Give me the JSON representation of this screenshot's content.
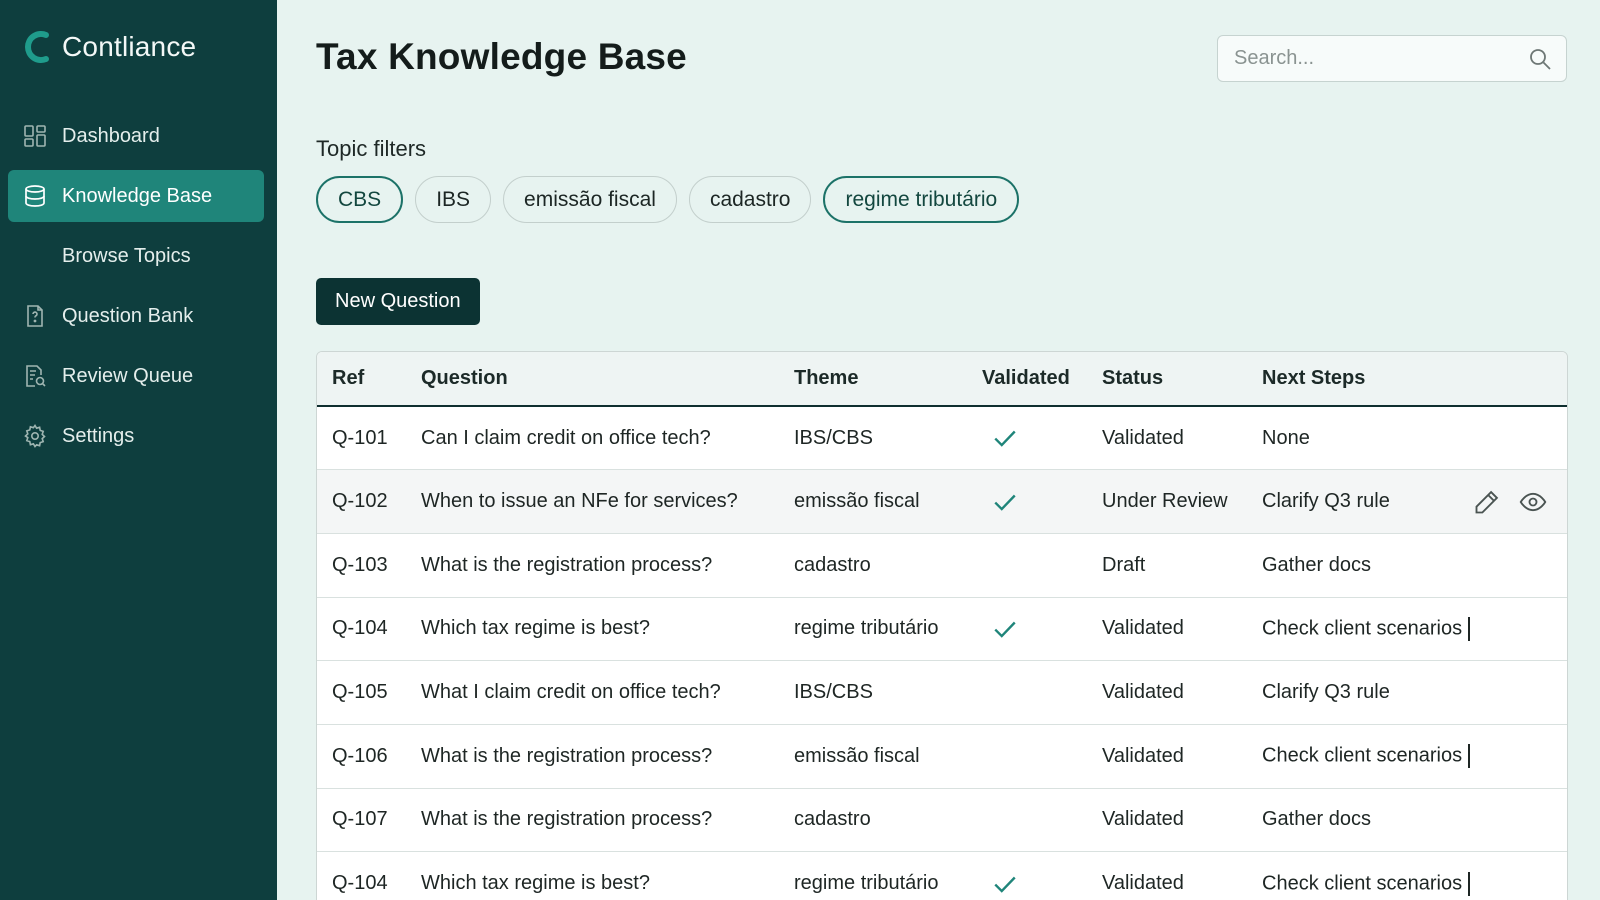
{
  "brand": {
    "name": "Contliance",
    "accent": "#1f857a"
  },
  "sidebar": {
    "items": [
      {
        "label": "Dashboard",
        "icon": "grid-icon",
        "active": false
      },
      {
        "label": "Knowledge Base",
        "icon": "database-icon",
        "active": true
      },
      {
        "label": "Browse Topics",
        "icon": "",
        "active": false
      },
      {
        "label": "Question Bank",
        "icon": "question-file-icon",
        "active": false
      },
      {
        "label": "Review Queue",
        "icon": "review-search-icon",
        "active": false
      },
      {
        "label": "Settings",
        "icon": "gear-icon",
        "active": false
      }
    ]
  },
  "header": {
    "title": "Tax Knowledge Base",
    "search_placeholder": "Search..."
  },
  "filters": {
    "label": "Topic filters",
    "chips": [
      {
        "label": "CBS",
        "selected": true
      },
      {
        "label": "IBS",
        "selected": false
      },
      {
        "label": "emissão fiscal",
        "selected": false
      },
      {
        "label": "cadastro",
        "selected": false
      },
      {
        "label": "regime tributário",
        "selected": true
      }
    ]
  },
  "actions": {
    "new_question": "New Question"
  },
  "table": {
    "columns": [
      "Ref",
      "Question",
      "Theme",
      "Validated",
      "Status",
      "Next Steps"
    ],
    "rows": [
      {
        "ref": "Q-101",
        "question": "Can I claim credit on office tech?",
        "theme": "IBS/CBS",
        "validated": true,
        "status": "Validated",
        "next": "None"
      },
      {
        "ref": "Q-102",
        "question": "When to issue an NFe for services?",
        "theme": "emissão fiscal",
        "validated": true,
        "status": "Under Review",
        "next": "Clarify Q3 rule"
      },
      {
        "ref": "Q-103",
        "question": "What is the registration process?",
        "theme": "cadastro",
        "validated": false,
        "status": "Draft",
        "next": "Gather docs"
      },
      {
        "ref": "Q-104",
        "question": "Which tax regime is best?",
        "theme": "regime tributário",
        "validated": true,
        "status": "Validated",
        "next": "Check client scenarios"
      },
      {
        "ref": "Q-105",
        "question": "What I claim credit on office tech?",
        "theme": "IBS/CBS",
        "validated": false,
        "status": "Validated",
        "next": "Clarify Q3 rule"
      },
      {
        "ref": "Q-106",
        "question": "What is the registration process?",
        "theme": "emissão fiscal",
        "validated": false,
        "status": "Validated",
        "next": "Check client scenarios"
      },
      {
        "ref": "Q-107",
        "question": "What is the registration process?",
        "theme": "cadastro",
        "validated": false,
        "status": "Validated",
        "next": "Gather docs"
      },
      {
        "ref": "Q-104",
        "question": "Which tax regime is best?",
        "theme": "regime tributário",
        "validated": true,
        "status": "Validated",
        "next": "Check client scenarios"
      }
    ]
  }
}
